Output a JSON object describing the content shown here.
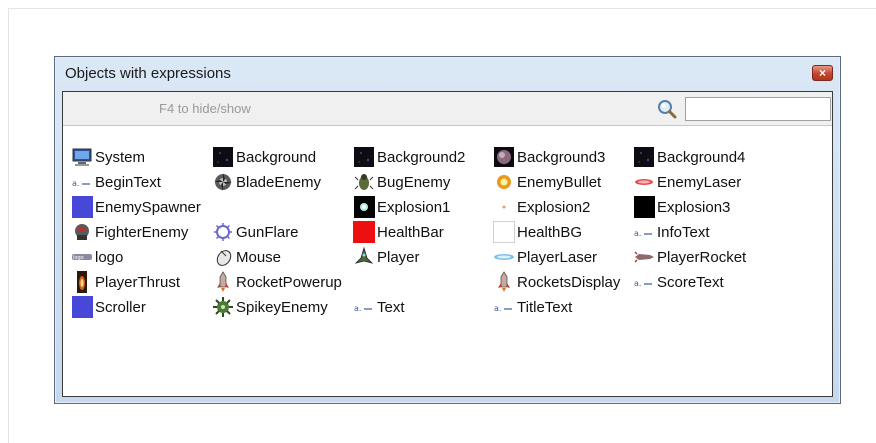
{
  "dialog": {
    "title": "Objects with expressions",
    "close_label": "×"
  },
  "toolbar": {
    "hint": "F4 to hide/show",
    "search_value": ""
  },
  "objects": [
    {
      "label": "System",
      "icon": "monitor-icon"
    },
    {
      "label": "Background",
      "icon": "dark-sprite-icon"
    },
    {
      "label": "Background2",
      "icon": "dark-sprite-icon"
    },
    {
      "label": "Background3",
      "icon": "planet-icon"
    },
    {
      "label": "Background4",
      "icon": "dark-sprite-icon"
    },
    {
      "label": "BeginText",
      "icon": "text-icon"
    },
    {
      "label": "BladeEnemy",
      "icon": "blade-icon"
    },
    {
      "label": "BugEnemy",
      "icon": "bug-icon"
    },
    {
      "label": "EnemyBullet",
      "icon": "bullet-icon"
    },
    {
      "label": "EnemyLaser",
      "icon": "laser-icon"
    },
    {
      "label": "EnemySpawner",
      "icon": "blue-square-icon"
    },
    {
      "label": "Explosion1",
      "icon": "explosion-icon"
    },
    {
      "label": "Explosion2",
      "icon": "spark-icon"
    },
    {
      "label": "Explosion3",
      "icon": "black-square-icon"
    },
    {
      "label": "FighterEnemy",
      "icon": "fighter-icon"
    },
    {
      "label": "GunFlare",
      "icon": "flare-icon"
    },
    {
      "label": "HealthBar",
      "icon": "red-square-icon"
    },
    {
      "label": "HealthBG",
      "icon": "white-square-icon"
    },
    {
      "label": "InfoText",
      "icon": "text-icon"
    },
    {
      "label": "logo",
      "icon": "logo-icon"
    },
    {
      "label": "Mouse",
      "icon": "mouse-icon"
    },
    {
      "label": "Player",
      "icon": "ship-icon"
    },
    {
      "label": "PlayerLaser",
      "icon": "blue-laser-icon"
    },
    {
      "label": "PlayerRocket",
      "icon": "rocket-side-icon"
    },
    {
      "label": "PlayerThrust",
      "icon": "thrust-icon"
    },
    {
      "label": "RocketPowerup",
      "icon": "rocket-icon"
    },
    {
      "label": "RocketsDisplay",
      "icon": "rocket-icon"
    },
    {
      "label": "ScoreText",
      "icon": "text-icon"
    },
    {
      "label": "Scroller",
      "icon": "blue-square-icon"
    },
    {
      "label": "SpikeyEnemy",
      "icon": "spikey-icon"
    },
    {
      "label": "Text",
      "icon": "text-icon"
    },
    {
      "label": "TitleText",
      "icon": "text-icon"
    }
  ]
}
